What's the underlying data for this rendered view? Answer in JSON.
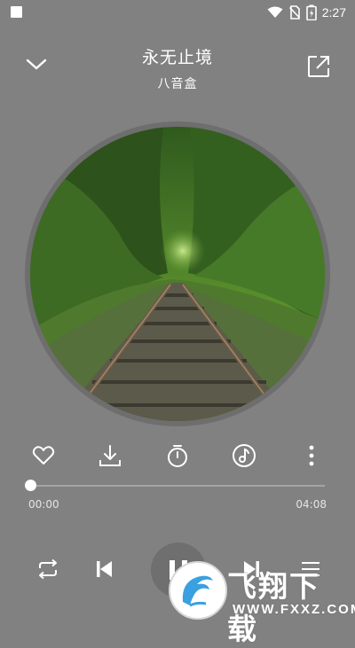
{
  "status_bar": {
    "time": "2:27"
  },
  "header": {
    "title": "永无止境",
    "artist": "八音盒"
  },
  "playback": {
    "current_time": "00:00",
    "total_time": "04:08",
    "progress": 0.0
  },
  "actions": [
    "heart-icon",
    "download-icon",
    "timer-icon",
    "music-note-icon",
    "more-vert-icon"
  ],
  "controls": [
    "repeat-icon",
    "previous-icon",
    "pause-icon",
    "next-icon",
    "playlist-icon"
  ],
  "watermark": {
    "brand": "飞翔下载",
    "url": "WWW.FXXZ.COM"
  },
  "colors": {
    "background": "#818181",
    "foreground": "#ffffff",
    "watermark_accent": "#3aa0e0"
  }
}
